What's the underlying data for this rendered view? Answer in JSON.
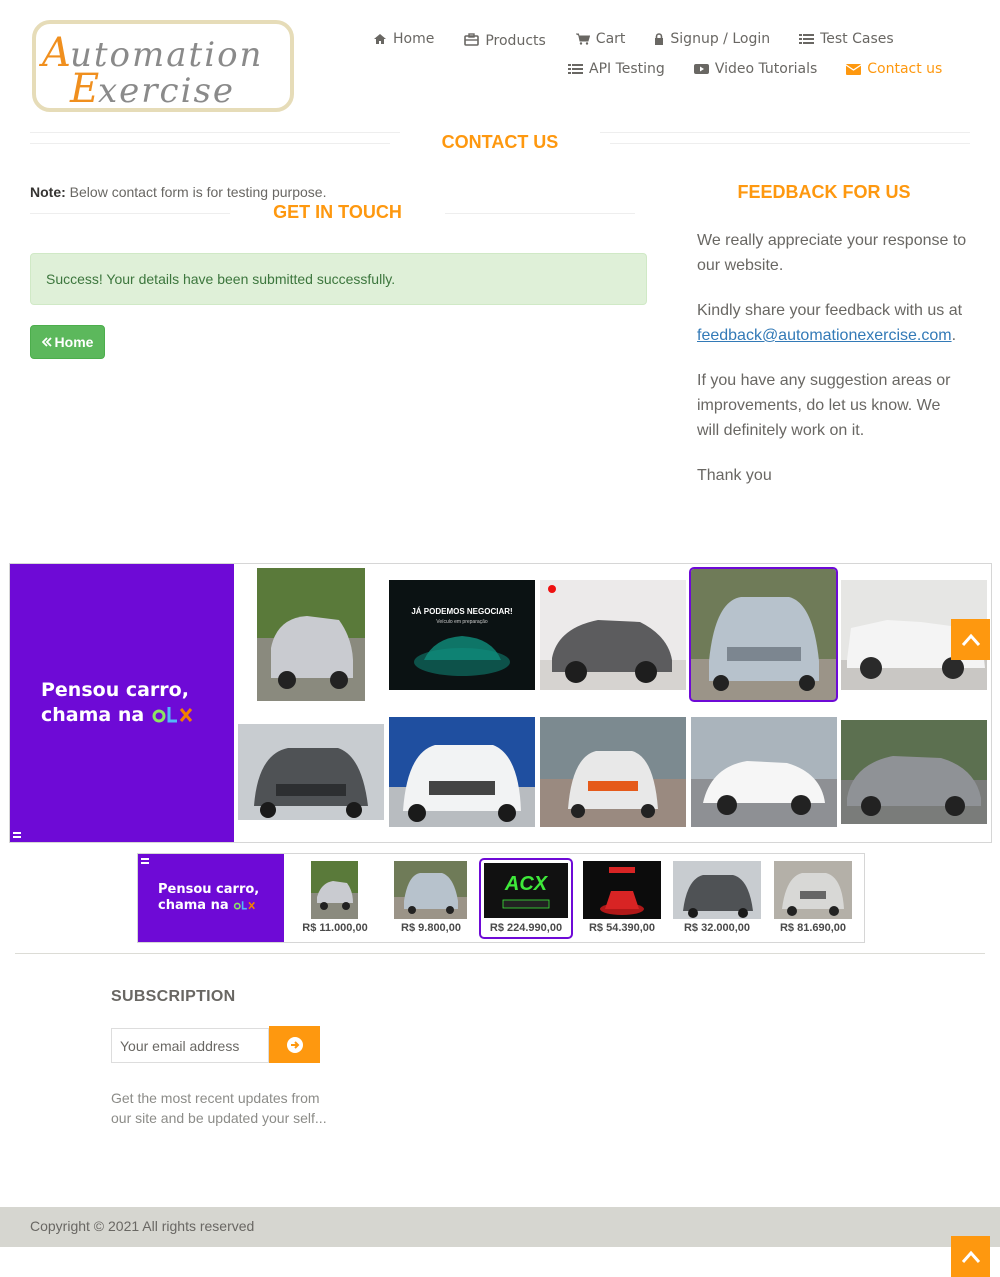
{
  "brand": {
    "logo_text_1": "Automation",
    "logo_text_2": "Exercise"
  },
  "nav": {
    "items": [
      {
        "label": "Home",
        "icon": "home-icon"
      },
      {
        "label": "Products",
        "icon": "briefcase-icon"
      },
      {
        "label": "Cart",
        "icon": "cart-icon"
      },
      {
        "label": "Signup / Login",
        "icon": "lock-icon"
      },
      {
        "label": "Test Cases",
        "icon": "list-icon"
      },
      {
        "label": "API Testing",
        "icon": "list-icon"
      },
      {
        "label": "Video Tutorials",
        "icon": "youtube-icon"
      },
      {
        "label": "Contact us",
        "icon": "envelope-icon",
        "active": true
      }
    ]
  },
  "contact": {
    "title": "CONTACT US",
    "note_label": "Note:",
    "note_text": " Below contact form is for testing purpose.",
    "get_in_touch": "GET IN TOUCH",
    "success_message": "Success! Your details have been submitted successfully.",
    "home_button": "Home"
  },
  "feedback": {
    "title": "FEEDBACK FOR US",
    "p1": "We really appreciate your response to our website.",
    "p2_prefix": "Kindly share your feedback with us at ",
    "email": "feedback@automationexercise.com",
    "p2_suffix": ".",
    "p3": "If you have any suggestion areas or improvements, do let us know. We will definitely work on it.",
    "p4": "Thank you"
  },
  "ads": {
    "promo_line1": "Pensou carro,",
    "promo_line2": "chama na",
    "promo_brand": "OLX",
    "tile_texts": {
      "negociar_title": "JÁ PODEMOS NEGOCIAR!",
      "negociar_sub": "Veículo em preparação",
      "acx": "ACX"
    },
    "prices": [
      "R$ 11.000,00",
      "R$ 9.800,00",
      "R$ 224.990,00",
      "R$ 54.390,00",
      "R$ 32.000,00",
      "R$ 81.690,00"
    ],
    "colors": {
      "olx_purple": "#6e0ad6",
      "olx_orange": "#f28000",
      "olx_green": "#8ce563"
    }
  },
  "subscription": {
    "title": "SUBSCRIPTION",
    "placeholder": "Your email address",
    "description": "Get the most recent updates from our site and be updated your self..."
  },
  "footer": {
    "copyright": "Copyright © 2021 All rights reserved"
  },
  "colors": {
    "accent": "#fe980f",
    "success_bg": "#dff0d8",
    "success_text": "#3c763d",
    "button_green": "#5cb85c",
    "link": "#337ab7"
  }
}
